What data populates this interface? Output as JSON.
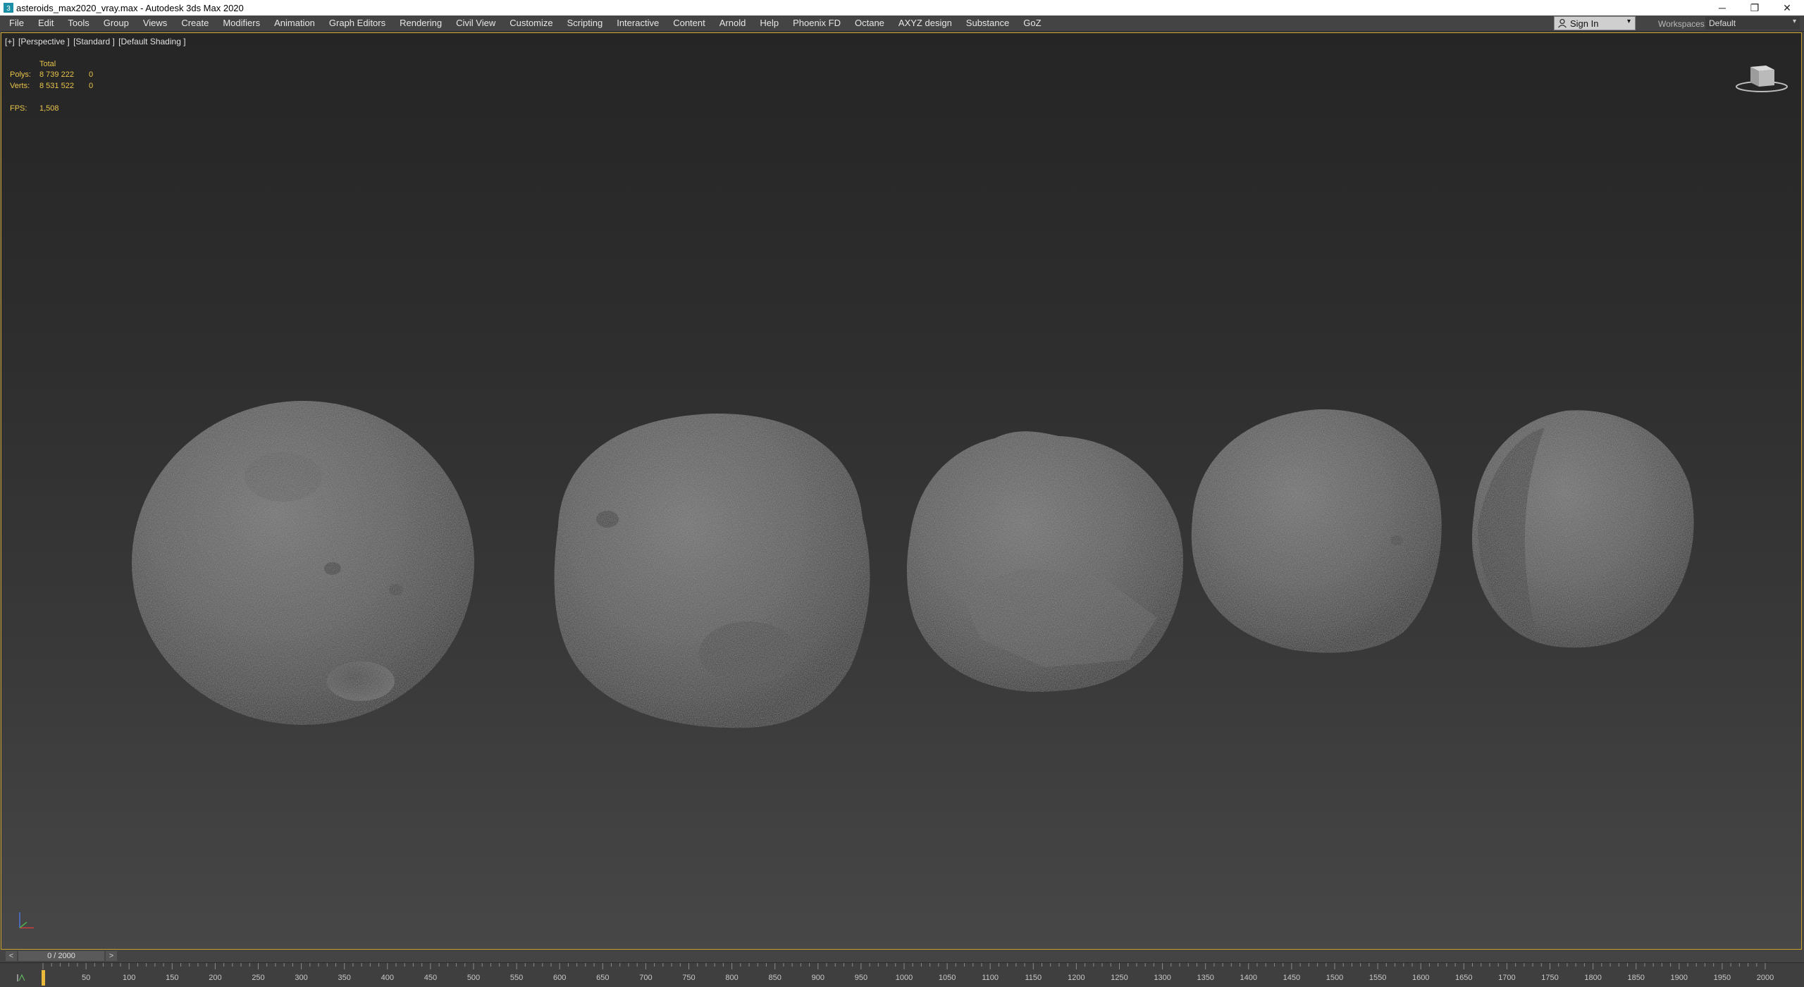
{
  "window": {
    "title": "asteroids_max2020_vray.max - Autodesk 3ds Max 2020",
    "minimize": "─",
    "maximize": "❐",
    "close": "✕"
  },
  "menu": [
    "File",
    "Edit",
    "Tools",
    "Group",
    "Views",
    "Create",
    "Modifiers",
    "Animation",
    "Graph Editors",
    "Rendering",
    "Civil View",
    "Customize",
    "Scripting",
    "Interactive",
    "Content",
    "Arnold",
    "Help",
    "Phoenix FD",
    "Octane",
    "AXYZ design",
    "Substance",
    "GoZ"
  ],
  "account": {
    "sign_in": "Sign In",
    "caret": "▾"
  },
  "workspace": {
    "label": "Workspaces:",
    "value": "Default",
    "caret": "▾"
  },
  "viewport": {
    "label_plus": "[+]",
    "label_view": "[Perspective ]",
    "label_mode": "[Standard ]",
    "label_shading": "[Default Shading ]",
    "stats": {
      "header": "Total",
      "polys_label": "Polys:",
      "polys_total": "8 739 222",
      "polys_sel": "0",
      "verts_label": "Verts:",
      "verts_total": "8 531 522",
      "verts_sel": "0",
      "fps_label": "FPS:",
      "fps_value": "1,508"
    }
  },
  "timeline": {
    "prev": "<",
    "frame_display": "0 / 2000",
    "next": ">",
    "ticks": [
      "50",
      "100",
      "150",
      "200",
      "250",
      "300",
      "350",
      "400",
      "450",
      "500",
      "550",
      "600",
      "650",
      "700",
      "750",
      "800",
      "850",
      "900",
      "950",
      "1000",
      "1050",
      "1100",
      "1150",
      "1200",
      "1250",
      "1300",
      "1350",
      "1400",
      "1450",
      "1500",
      "1550",
      "1600",
      "1650",
      "1700",
      "1750",
      "1800",
      "1850",
      "1900",
      "1950",
      "2000"
    ]
  },
  "colors": {
    "viewport_border": "#c8a12a",
    "stats_text": "#e8c44a",
    "timeline_marker": "#e8b93a"
  }
}
